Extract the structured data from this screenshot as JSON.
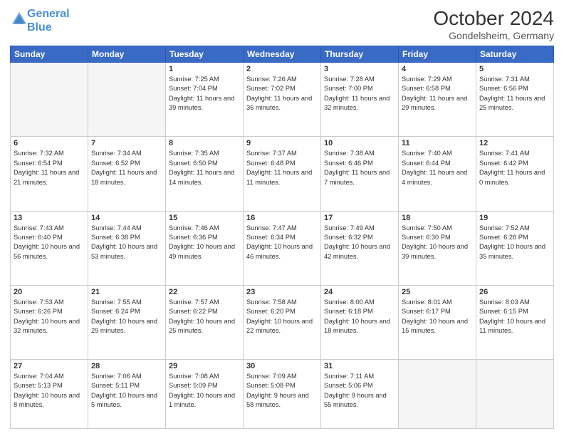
{
  "header": {
    "logo_line1": "General",
    "logo_line2": "Blue",
    "month_year": "October 2024",
    "location": "Gondelsheim, Germany"
  },
  "weekdays": [
    "Sunday",
    "Monday",
    "Tuesday",
    "Wednesday",
    "Thursday",
    "Friday",
    "Saturday"
  ],
  "weeks": [
    [
      {
        "day": "",
        "info": ""
      },
      {
        "day": "",
        "info": ""
      },
      {
        "day": "1",
        "info": "Sunrise: 7:25 AM\nSunset: 7:04 PM\nDaylight: 11 hours and 39 minutes."
      },
      {
        "day": "2",
        "info": "Sunrise: 7:26 AM\nSunset: 7:02 PM\nDaylight: 11 hours and 36 minutes."
      },
      {
        "day": "3",
        "info": "Sunrise: 7:28 AM\nSunset: 7:00 PM\nDaylight: 11 hours and 32 minutes."
      },
      {
        "day": "4",
        "info": "Sunrise: 7:29 AM\nSunset: 6:58 PM\nDaylight: 11 hours and 29 minutes."
      },
      {
        "day": "5",
        "info": "Sunrise: 7:31 AM\nSunset: 6:56 PM\nDaylight: 11 hours and 25 minutes."
      }
    ],
    [
      {
        "day": "6",
        "info": "Sunrise: 7:32 AM\nSunset: 6:54 PM\nDaylight: 11 hours and 21 minutes."
      },
      {
        "day": "7",
        "info": "Sunrise: 7:34 AM\nSunset: 6:52 PM\nDaylight: 11 hours and 18 minutes."
      },
      {
        "day": "8",
        "info": "Sunrise: 7:35 AM\nSunset: 6:50 PM\nDaylight: 11 hours and 14 minutes."
      },
      {
        "day": "9",
        "info": "Sunrise: 7:37 AM\nSunset: 6:48 PM\nDaylight: 11 hours and 11 minutes."
      },
      {
        "day": "10",
        "info": "Sunrise: 7:38 AM\nSunset: 6:46 PM\nDaylight: 11 hours and 7 minutes."
      },
      {
        "day": "11",
        "info": "Sunrise: 7:40 AM\nSunset: 6:44 PM\nDaylight: 11 hours and 4 minutes."
      },
      {
        "day": "12",
        "info": "Sunrise: 7:41 AM\nSunset: 6:42 PM\nDaylight: 11 hours and 0 minutes."
      }
    ],
    [
      {
        "day": "13",
        "info": "Sunrise: 7:43 AM\nSunset: 6:40 PM\nDaylight: 10 hours and 56 minutes."
      },
      {
        "day": "14",
        "info": "Sunrise: 7:44 AM\nSunset: 6:38 PM\nDaylight: 10 hours and 53 minutes."
      },
      {
        "day": "15",
        "info": "Sunrise: 7:46 AM\nSunset: 6:36 PM\nDaylight: 10 hours and 49 minutes."
      },
      {
        "day": "16",
        "info": "Sunrise: 7:47 AM\nSunset: 6:34 PM\nDaylight: 10 hours and 46 minutes."
      },
      {
        "day": "17",
        "info": "Sunrise: 7:49 AM\nSunset: 6:32 PM\nDaylight: 10 hours and 42 minutes."
      },
      {
        "day": "18",
        "info": "Sunrise: 7:50 AM\nSunset: 6:30 PM\nDaylight: 10 hours and 39 minutes."
      },
      {
        "day": "19",
        "info": "Sunrise: 7:52 AM\nSunset: 6:28 PM\nDaylight: 10 hours and 35 minutes."
      }
    ],
    [
      {
        "day": "20",
        "info": "Sunrise: 7:53 AM\nSunset: 6:26 PM\nDaylight: 10 hours and 32 minutes."
      },
      {
        "day": "21",
        "info": "Sunrise: 7:55 AM\nSunset: 6:24 PM\nDaylight: 10 hours and 29 minutes."
      },
      {
        "day": "22",
        "info": "Sunrise: 7:57 AM\nSunset: 6:22 PM\nDaylight: 10 hours and 25 minutes."
      },
      {
        "day": "23",
        "info": "Sunrise: 7:58 AM\nSunset: 6:20 PM\nDaylight: 10 hours and 22 minutes."
      },
      {
        "day": "24",
        "info": "Sunrise: 8:00 AM\nSunset: 6:18 PM\nDaylight: 10 hours and 18 minutes."
      },
      {
        "day": "25",
        "info": "Sunrise: 8:01 AM\nSunset: 6:17 PM\nDaylight: 10 hours and 15 minutes."
      },
      {
        "day": "26",
        "info": "Sunrise: 8:03 AM\nSunset: 6:15 PM\nDaylight: 10 hours and 11 minutes."
      }
    ],
    [
      {
        "day": "27",
        "info": "Sunrise: 7:04 AM\nSunset: 5:13 PM\nDaylight: 10 hours and 8 minutes."
      },
      {
        "day": "28",
        "info": "Sunrise: 7:06 AM\nSunset: 5:11 PM\nDaylight: 10 hours and 5 minutes."
      },
      {
        "day": "29",
        "info": "Sunrise: 7:08 AM\nSunset: 5:09 PM\nDaylight: 10 hours and 1 minute."
      },
      {
        "day": "30",
        "info": "Sunrise: 7:09 AM\nSunset: 5:08 PM\nDaylight: 9 hours and 58 minutes."
      },
      {
        "day": "31",
        "info": "Sunrise: 7:11 AM\nSunset: 5:06 PM\nDaylight: 9 hours and 55 minutes."
      },
      {
        "day": "",
        "info": ""
      },
      {
        "day": "",
        "info": ""
      }
    ]
  ]
}
